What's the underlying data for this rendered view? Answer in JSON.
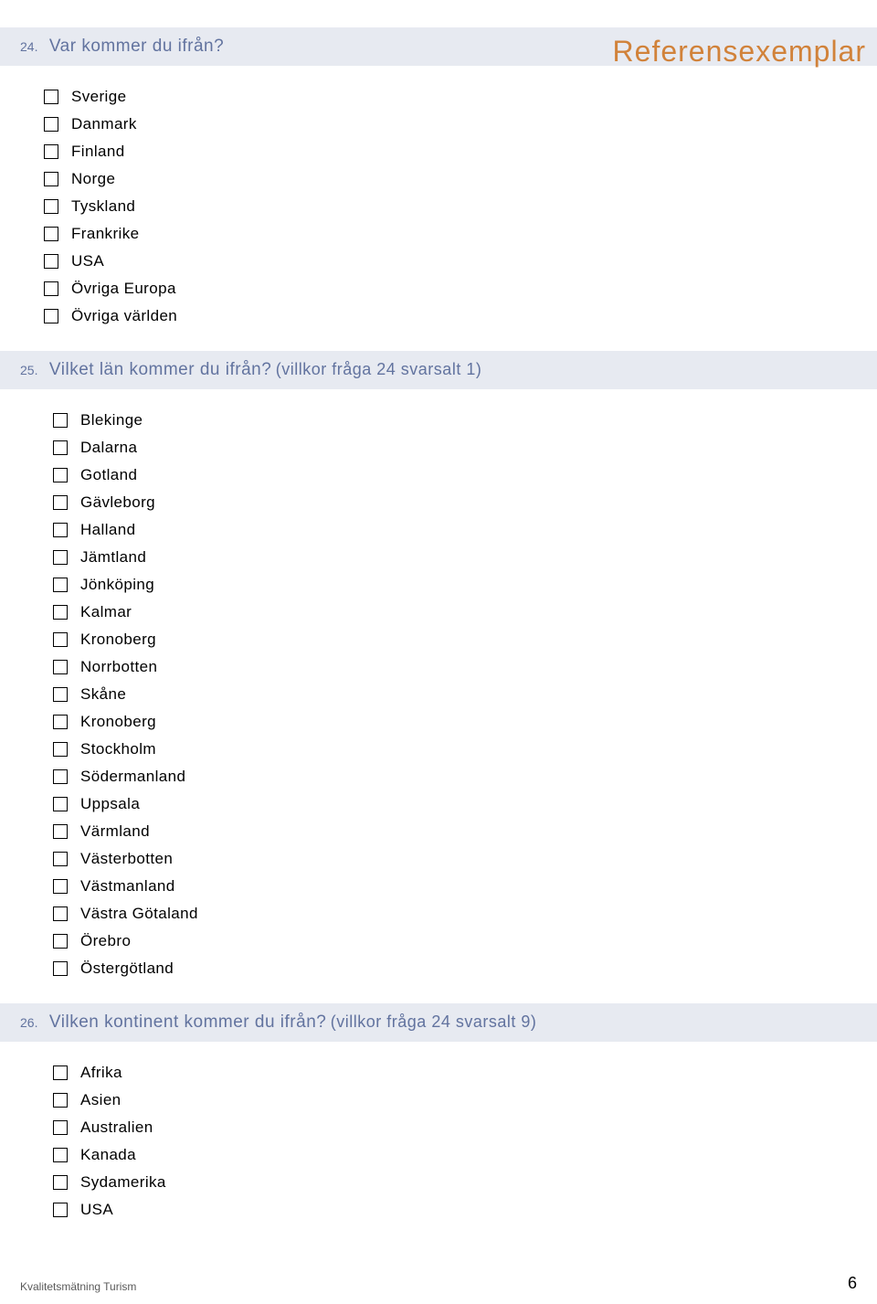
{
  "watermark": "Referensexemplar",
  "questions": {
    "q24": {
      "number": "24.",
      "text": "Var kommer du ifrån?"
    },
    "q25": {
      "number": "25.",
      "text": "Vilket län kommer du ifrån?",
      "condition": "(villkor fråga 24 svarsalt 1)"
    },
    "q26": {
      "number": "26.",
      "text": "Vilken kontinent kommer du ifrån?",
      "condition": "(villkor fråga 24 svarsalt 9)"
    }
  },
  "options24": [
    "Sverige",
    "Danmark",
    "Finland",
    "Norge",
    "Tyskland",
    "Frankrike",
    "USA",
    "Övriga Europa",
    "Övriga världen"
  ],
  "options25": [
    "Blekinge",
    "Dalarna",
    "Gotland",
    "Gävleborg",
    "Halland",
    "Jämtland",
    "Jönköping",
    "Kalmar",
    "Kronoberg",
    "Norrbotten",
    "Skåne",
    "Kronoberg",
    "Stockholm",
    "Södermanland",
    "Uppsala",
    "Värmland",
    "Västerbotten",
    "Västmanland",
    "Västra Götaland",
    "Örebro",
    "Östergötland"
  ],
  "options26": [
    "Afrika",
    "Asien",
    "Australien",
    "Kanada",
    "Sydamerika",
    "USA"
  ],
  "footer": {
    "title": "Kvalitetsmätning Turism",
    "page": "6"
  }
}
